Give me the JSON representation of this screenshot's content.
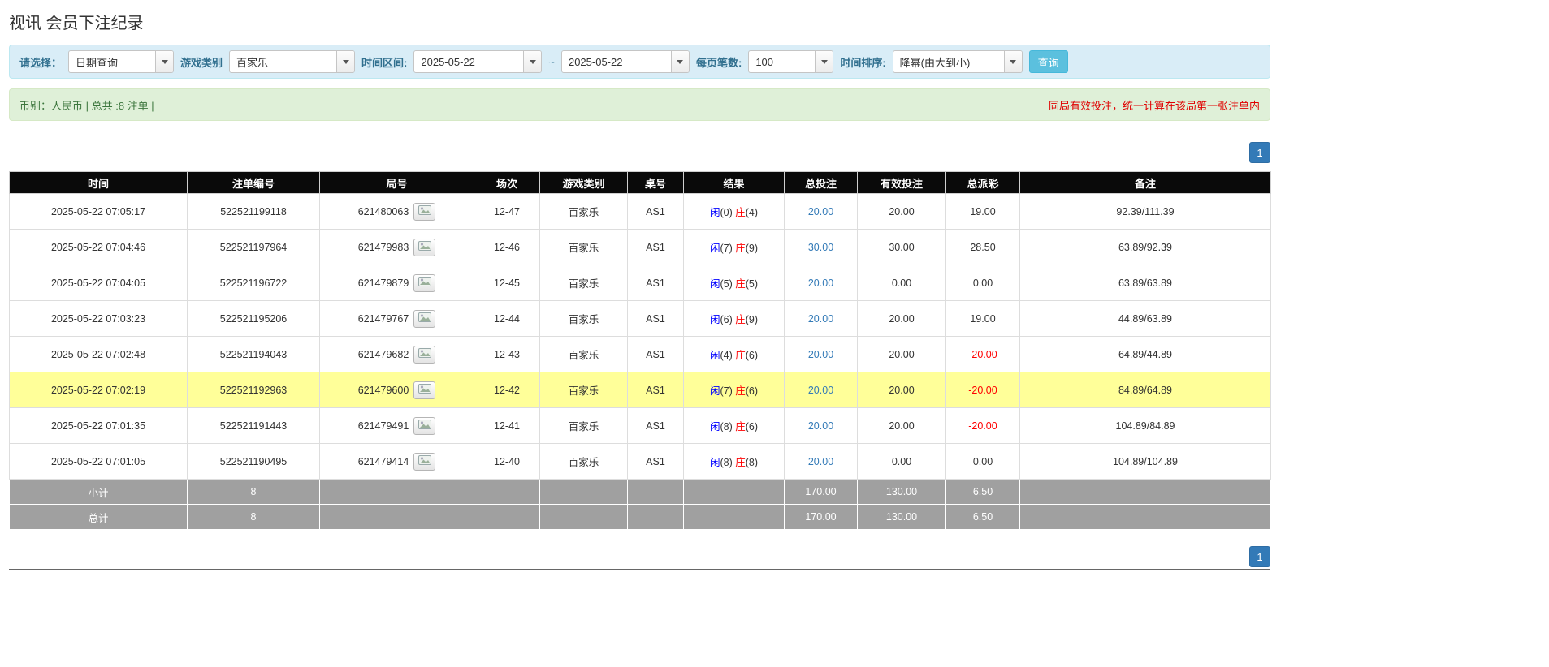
{
  "page": {
    "title": "视讯 会员下注纪录"
  },
  "filters": {
    "select_label": "请选择：",
    "query_type": "日期查询",
    "game_type_label": "游戏类别",
    "game_type": "百家乐",
    "time_range_label": "时间区间:",
    "date_from": "2025-05-22",
    "range_separator": "~",
    "date_to": "2025-05-22",
    "page_size_label": "每页笔数:",
    "page_size": "100",
    "sort_label": "时间排序:",
    "sort_order": "降幂(由大到小)",
    "search_button": "查询"
  },
  "summary": {
    "currency_info": "币别：人民币 | 总共 :8 注单 |",
    "notice": "同局有效投注，统一计算在该局第一张注单内"
  },
  "pagination": {
    "page": "1"
  },
  "icons": {
    "dropdown_caret": "caret-down",
    "round_detail": "game-image-icon"
  },
  "colors": {
    "filter_bar_bg": "#d9edf7",
    "summary_bar_bg": "#dff0d8",
    "query_button": "#5bc0de",
    "pagination_blue": "#337ab7",
    "header_bg": "#000000",
    "footer_bg": "#a0a0a0",
    "highlight_row": "#ffff99",
    "player_blue": "#0000ff",
    "banker_red": "#ff0000",
    "negative_red": "#ff0000",
    "notice_red": "#e00000"
  },
  "table": {
    "headers": [
      "时间",
      "注单编号",
      "局号",
      "场次",
      "游戏类别",
      "桌号",
      "结果",
      "总投注",
      "有效投注",
      "总派彩",
      "备注"
    ],
    "rows": [
      {
        "time": "2025-05-22 07:05:17",
        "bet_id": "522521199118",
        "round": "621480063",
        "session": "12-47",
        "game": "百家乐",
        "table_no": "AS1",
        "player": "闲",
        "player_pts": "(0)",
        "banker": "庄",
        "banker_pts": "(4)",
        "total_bet": "20.00",
        "valid_bet": "20.00",
        "payout": "19.00",
        "note": "92.39/111.39",
        "highlighted": false
      },
      {
        "time": "2025-05-22 07:04:46",
        "bet_id": "522521197964",
        "round": "621479983",
        "session": "12-46",
        "game": "百家乐",
        "table_no": "AS1",
        "player": "闲",
        "player_pts": "(7)",
        "banker": "庄",
        "banker_pts": "(9)",
        "total_bet": "30.00",
        "valid_bet": "30.00",
        "payout": "28.50",
        "note": "63.89/92.39",
        "highlighted": false
      },
      {
        "time": "2025-05-22 07:04:05",
        "bet_id": "522521196722",
        "round": "621479879",
        "session": "12-45",
        "game": "百家乐",
        "table_no": "AS1",
        "player": "闲",
        "player_pts": "(5)",
        "banker": "庄",
        "banker_pts": "(5)",
        "total_bet": "20.00",
        "valid_bet": "0.00",
        "payout": "0.00",
        "note": "63.89/63.89",
        "highlighted": false
      },
      {
        "time": "2025-05-22 07:03:23",
        "bet_id": "522521195206",
        "round": "621479767",
        "session": "12-44",
        "game": "百家乐",
        "table_no": "AS1",
        "player": "闲",
        "player_pts": "(6)",
        "banker": "庄",
        "banker_pts": "(9)",
        "total_bet": "20.00",
        "valid_bet": "20.00",
        "payout": "19.00",
        "note": "44.89/63.89",
        "highlighted": false
      },
      {
        "time": "2025-05-22 07:02:48",
        "bet_id": "522521194043",
        "round": "621479682",
        "session": "12-43",
        "game": "百家乐",
        "table_no": "AS1",
        "player": "闲",
        "player_pts": "(4)",
        "banker": "庄",
        "banker_pts": "(6)",
        "total_bet": "20.00",
        "valid_bet": "20.00",
        "payout": "-20.00",
        "note": "64.89/44.89",
        "highlighted": false
      },
      {
        "time": "2025-05-22 07:02:19",
        "bet_id": "522521192963",
        "round": "621479600",
        "session": "12-42",
        "game": "百家乐",
        "table_no": "AS1",
        "player": "闲",
        "player_pts": "(7)",
        "banker": "庄",
        "banker_pts": "(6)",
        "total_bet": "20.00",
        "valid_bet": "20.00",
        "payout": "-20.00",
        "note": "84.89/64.89",
        "highlighted": true
      },
      {
        "time": "2025-05-22 07:01:35",
        "bet_id": "522521191443",
        "round": "621479491",
        "session": "12-41",
        "game": "百家乐",
        "table_no": "AS1",
        "player": "闲",
        "player_pts": "(8)",
        "banker": "庄",
        "banker_pts": "(6)",
        "total_bet": "20.00",
        "valid_bet": "20.00",
        "payout": "-20.00",
        "note": "104.89/84.89",
        "highlighted": false
      },
      {
        "time": "2025-05-22 07:01:05",
        "bet_id": "522521190495",
        "round": "621479414",
        "session": "12-40",
        "game": "百家乐",
        "table_no": "AS1",
        "player": "闲",
        "player_pts": "(8)",
        "banker": "庄",
        "banker_pts": "(8)",
        "total_bet": "20.00",
        "valid_bet": "0.00",
        "payout": "0.00",
        "note": "104.89/104.89",
        "highlighted": false
      }
    ],
    "subtotal": {
      "label": "小计",
      "count": "8",
      "total_bet": "170.00",
      "valid_bet": "130.00",
      "payout": "6.50"
    },
    "total": {
      "label": "总计",
      "count": "8",
      "total_bet": "170.00",
      "valid_bet": "130.00",
      "payout": "6.50"
    }
  }
}
